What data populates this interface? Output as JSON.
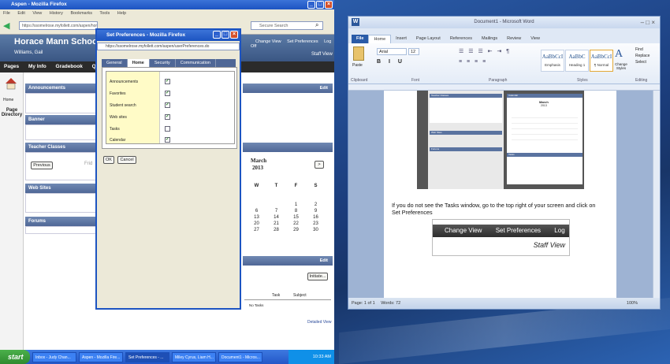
{
  "firefox": {
    "title": "Aspen - Mozilla Firefox",
    "menu": [
      "File",
      "Edit",
      "View",
      "History",
      "Bookmarks",
      "Tools",
      "Help"
    ],
    "url": "https://ssomelrose.myfollett.com/aspen/home.do",
    "search_placeholder": "Secure Search",
    "school_name": "Horace Mann School 2012-20",
    "user_name": "Williams, Gail",
    "top_links": [
      "Change View",
      "Set Preferences",
      "Log Off"
    ],
    "staff_view": "Staff View",
    "nav_tabs": [
      "Pages",
      "My Info",
      "Gradebook",
      "Qu"
    ],
    "sidebar": {
      "home": "Home",
      "page_directory": "Page Directory"
    },
    "panels": {
      "announcements": "Announcements",
      "banner": "Banner",
      "teacher_classes": "Teacher Classes",
      "previous": "Previous",
      "fri": "Frid",
      "web_sites": "Web Sites",
      "forums": "Forums",
      "edit": "Edit"
    },
    "calendar": {
      "month": "March",
      "year": "2013",
      "next": ">",
      "headers": [
        "W",
        "T",
        "F",
        "S"
      ],
      "rows": [
        [
          "",
          "",
          "1",
          "2"
        ],
        [
          "6",
          "7",
          "8",
          "9"
        ],
        [
          "13",
          "14",
          "15",
          "16"
        ],
        [
          "20",
          "21",
          "22",
          "23"
        ],
        [
          "27",
          "28",
          "29",
          "30"
        ]
      ]
    },
    "tasks": {
      "initiate": "Initiate...",
      "task_col": "Task",
      "subject_col": "Subject",
      "no_tasks": "No Tasks",
      "detailed_view": "Detailed View",
      "edit": "Edit"
    }
  },
  "dialog": {
    "title": "Set Preferences - Mozilla Firefox",
    "url": "https://ssomelrose.myfollett.com/aspen/userPreferences.do",
    "tabs": [
      "General",
      "Home",
      "Security",
      "Communication"
    ],
    "active_tab": "Home",
    "prefs": [
      {
        "label": "Announcements",
        "checked": true
      },
      {
        "label": "Favorites",
        "checked": true
      },
      {
        "label": "Student search",
        "checked": true
      },
      {
        "label": "Web sites",
        "checked": true
      },
      {
        "label": "Tasks",
        "checked": false
      },
      {
        "label": "Calendar",
        "checked": true
      }
    ],
    "ok": "OK",
    "cancel": "Cancel"
  },
  "taskbar": {
    "start": "start",
    "items": [
      "Inbox - Judy Chan...",
      "Aspen - Mozilla Fire...",
      "Set Preferences - ...",
      "Miley Cyrus, Liam H...",
      "Document1 - Micros..."
    ],
    "active_index": 2,
    "time": "10:33 AM"
  },
  "word": {
    "title": "Document1 - Microsoft Word",
    "tabs": [
      "File",
      "Home",
      "Insert",
      "Page Layout",
      "References",
      "Mailings",
      "Review",
      "View"
    ],
    "active_tab": "Home",
    "font": "Arial",
    "font_size": "12",
    "groups": [
      "Clipboard",
      "Font",
      "Paragraph",
      "Styles",
      "Editing"
    ],
    "paste": "Paste",
    "styles": [
      {
        "sample": "AaBbCcI",
        "name": "Emphasis"
      },
      {
        "sample": "AaBbC",
        "name": "Heading 1"
      },
      {
        "sample": "AaBbCcI",
        "name": "¶ Normal"
      }
    ],
    "change_styles": "Change Styles",
    "editing": [
      "Find",
      "Replace",
      "Select"
    ],
    "doc_text": "If you do not see the Tasks window, go to the top right of your screen and click on Set Preferences",
    "crop_links": [
      "Change View",
      "Set Preferences",
      "Log Off"
    ],
    "crop_staff_view": "Staff View",
    "status_page": "Page: 1 of 1",
    "status_words": "Words: 72",
    "zoom": "100%"
  },
  "thumbnail": {
    "teacher_classes": "Teacher Classes",
    "calendar": "Calendar",
    "tasks": "Tasks",
    "web_sites": "Web Sites",
    "forums": "Forums",
    "month": "March",
    "year": "2013"
  }
}
